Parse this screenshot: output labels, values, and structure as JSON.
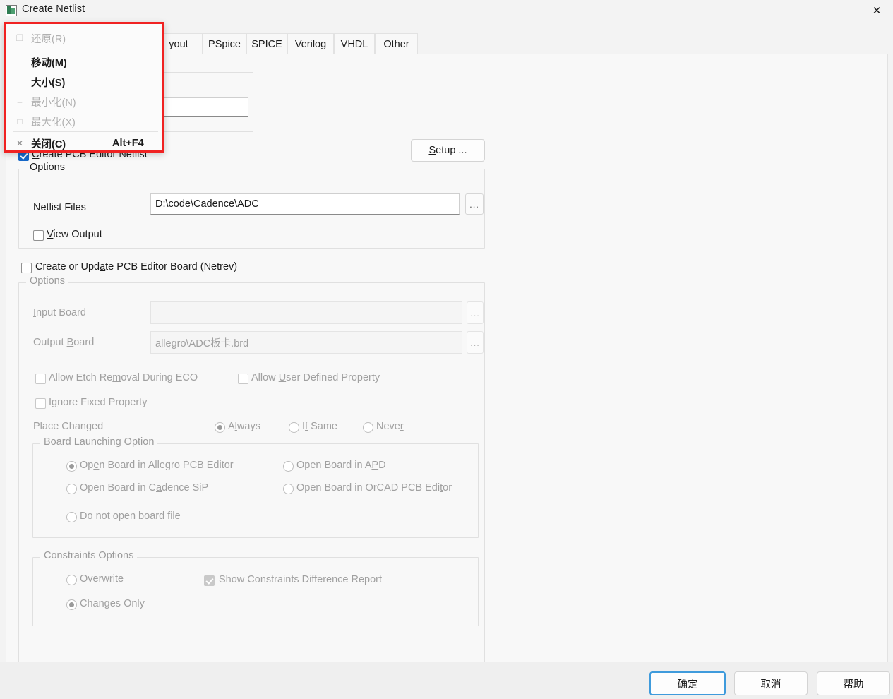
{
  "window": {
    "title": "Create Netlist",
    "icon": "netlist-app-icon",
    "close_icon": "✕"
  },
  "system_menu": {
    "items": [
      {
        "label": "还原(R)",
        "text": "还原",
        "mnemonic": "R",
        "accel": "",
        "enabled": false,
        "icon": "restore-icon",
        "glyph": "❐"
      },
      {
        "label": "移动(M)",
        "text": "移动",
        "mnemonic": "M",
        "accel": "",
        "enabled": true,
        "icon": "move-icon",
        "glyph": ""
      },
      {
        "label": "大小(S)",
        "text": "大小",
        "mnemonic": "S",
        "accel": "",
        "enabled": true,
        "icon": "size-icon",
        "glyph": ""
      },
      {
        "label": "最小化(N)",
        "text": "最小化",
        "mnemonic": "N",
        "accel": "",
        "enabled": false,
        "icon": "minimize-icon",
        "glyph": "–"
      },
      {
        "label": "最大化(X)",
        "text": "最大化",
        "mnemonic": "X",
        "accel": "",
        "enabled": false,
        "icon": "maximize-icon",
        "glyph": "□"
      },
      {
        "label": "关闭(C)",
        "text": "关闭",
        "mnemonic": "C",
        "accel": "Alt+F4",
        "enabled": true,
        "icon": "close-icon",
        "glyph": "✕"
      }
    ],
    "highlight_color": "#f02222"
  },
  "tabs": {
    "items": [
      {
        "label": "yout",
        "name": "tab-layout"
      },
      {
        "label": "PSpice",
        "name": "tab-pspice"
      },
      {
        "label": "SPICE",
        "name": "tab-spice"
      },
      {
        "label": "Verilog",
        "name": "tab-verilog"
      },
      {
        "label": "VHDL",
        "name": "tab-vhdl"
      },
      {
        "label": "Other",
        "name": "tab-other"
      }
    ],
    "selected": "yout"
  },
  "main": {
    "setup_button": {
      "pre": "S",
      "rest": "etup ..."
    },
    "create_netlist_checkbox": {
      "label_pre": "C",
      "label_rest": "reate PCB Editor Netlist",
      "checked": true
    },
    "netlist_options": {
      "group_title": "Options",
      "netlist_files_label": "Netlist Files",
      "netlist_files_value": "D:\\code\\Cadence\\ADC",
      "browse_label": "...",
      "view_output": {
        "pre": "V",
        "rest": "iew Output",
        "checked": false
      }
    },
    "netrev_checkbox": {
      "pre": "Create or Upd",
      "mn": "a",
      "post": "te PCB Editor Board (Netrev)",
      "checked": false
    },
    "netrev_options": {
      "group_title": "Options",
      "input_board_label_pre": "I",
      "input_board_label_rest": "nput Board",
      "input_board_value": "",
      "output_board_label_pre": "Output ",
      "output_board_label_mn": "B",
      "output_board_label_rest": "oard",
      "output_board_value": "allegro\\ADC板卡.brd",
      "browse_label": "...",
      "allow_etch": {
        "pre": "Allow Etch Re",
        "mn": "m",
        "post": "oval During ECO",
        "checked": false
      },
      "allow_user_prop": {
        "pre": "Allow ",
        "mn": "U",
        "post": "ser Defined Property",
        "checked": false
      },
      "ignore_fixed": {
        "pre": "I",
        "mn": "g",
        "post": "nore Fixed Property",
        "checked": false
      },
      "place_changed_label": "Place Changed",
      "place_changed_options": [
        {
          "pre": "A",
          "mn": "l",
          "post": "ways",
          "selected": true
        },
        {
          "pre": "I",
          "mn": "f",
          "post": " Same",
          "selected": false
        },
        {
          "pre": "Neve",
          "mn": "r",
          "post": "",
          "selected": false
        }
      ]
    },
    "board_launching": {
      "group_title": "Board Launching Option",
      "options": [
        {
          "pre": "Op",
          "mn": "e",
          "post": "n Board in Allegro PCB Editor",
          "selected": true,
          "name": "radio-open-allegro"
        },
        {
          "pre": "Open Board in C",
          "mn": "a",
          "post": "dence SiP",
          "selected": false,
          "name": "radio-open-cadence-sip"
        },
        {
          "pre": "Do not op",
          "mn": "e",
          "post": "n board file",
          "selected": false,
          "name": "radio-do-not-open"
        },
        {
          "pre": "Open Board in A",
          "mn": "P",
          "post": "D",
          "selected": false,
          "name": "radio-open-apd"
        },
        {
          "pre": "Open Board in OrCAD PCB Edi",
          "mn": "t",
          "post": "or",
          "selected": false,
          "name": "radio-open-orcad"
        }
      ]
    },
    "constraints": {
      "group_title": "Constraints Options",
      "options": [
        {
          "label": "Overwrite",
          "selected": false,
          "name": "radio-overwrite"
        },
        {
          "label": "Changes  Only",
          "selected": true,
          "name": "radio-changes-only"
        }
      ],
      "show_report": {
        "label": "Show Constraints Difference Report",
        "checked": true
      }
    }
  },
  "footer": {
    "ok": "确定",
    "cancel": "取消",
    "help": "帮助"
  }
}
